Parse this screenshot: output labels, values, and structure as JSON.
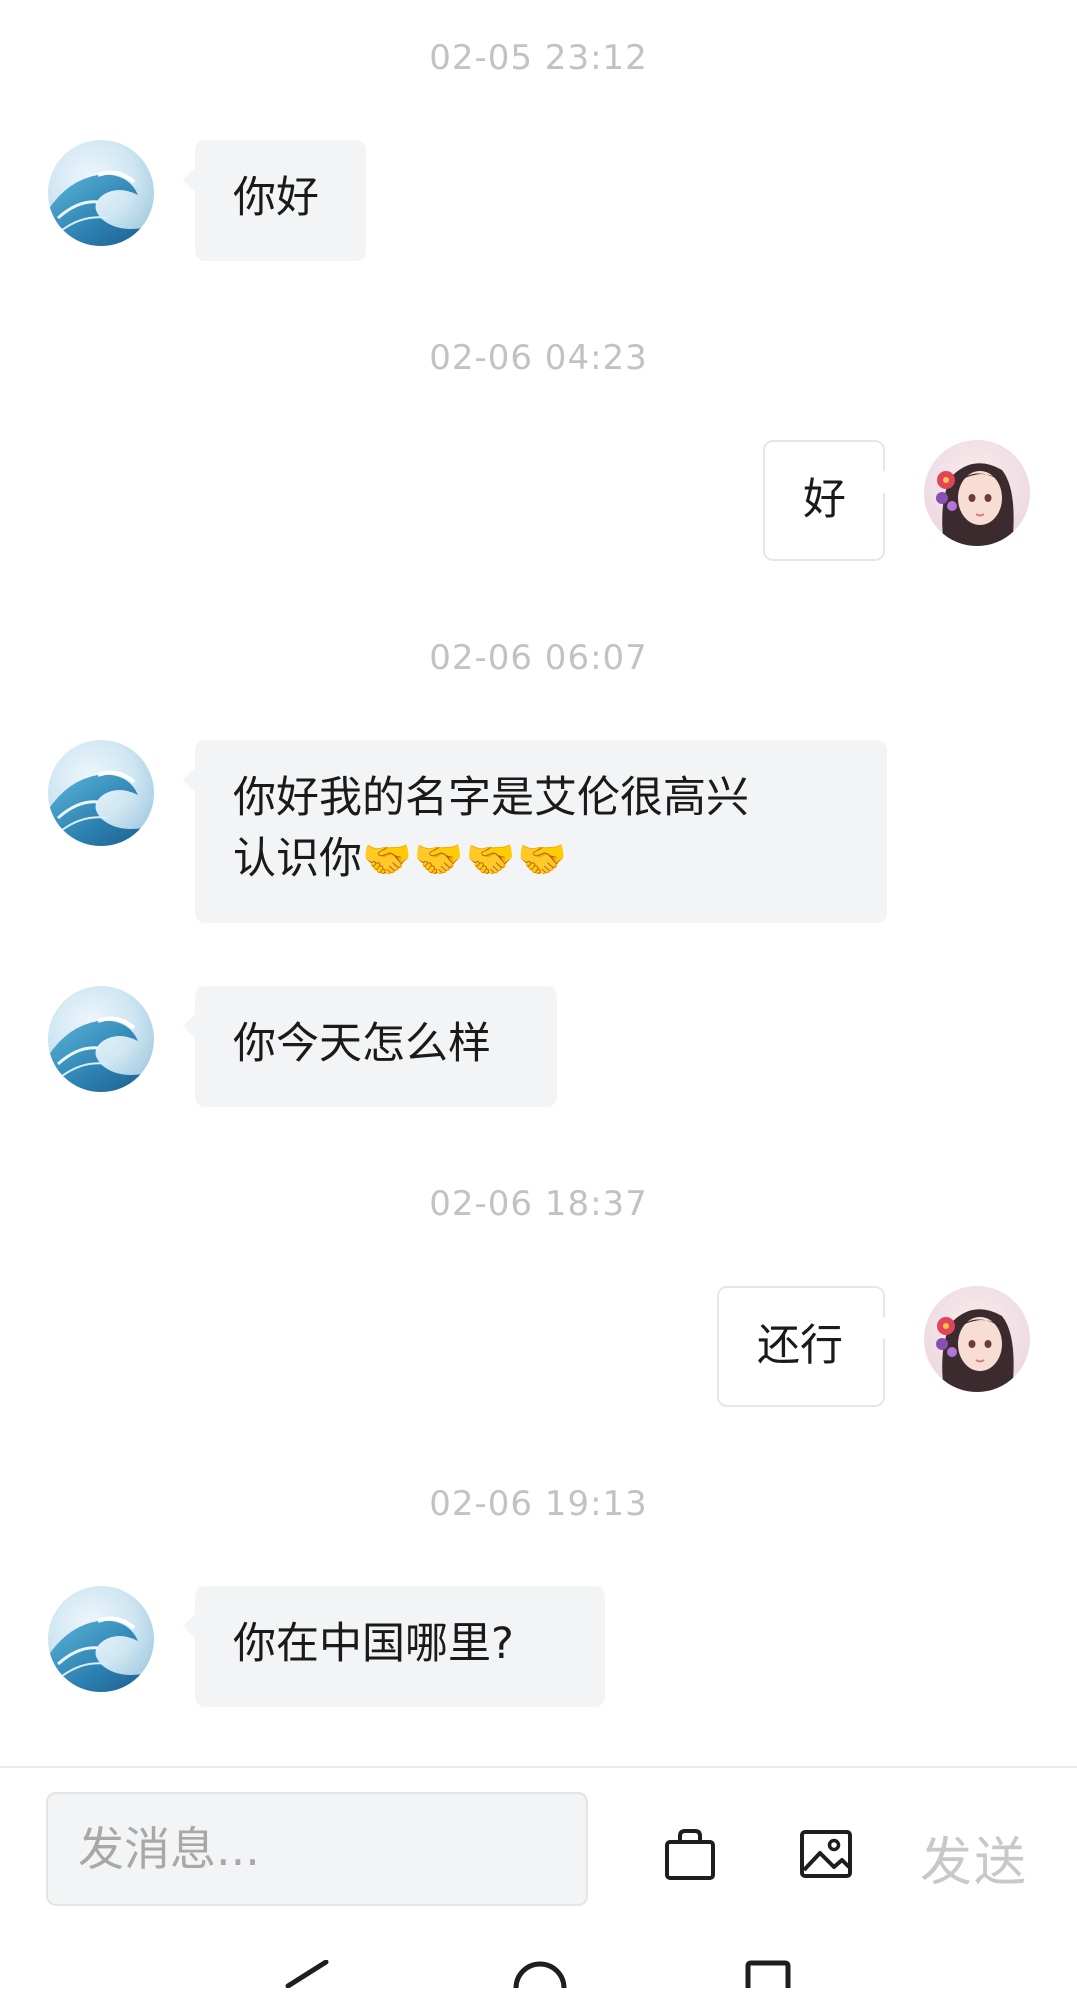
{
  "messages": [
    {
      "timestamp": "02-05 23:12",
      "side": "left",
      "text": "你好"
    },
    {
      "timestamp": "02-06 04:23",
      "side": "right",
      "text": "好"
    },
    {
      "timestamp": "02-06 06:07",
      "side": "left",
      "text": "你好我的名字是艾伦很高兴",
      "text_line2": "认识你",
      "emoji": "🤝🤝🤝🤝"
    },
    {
      "side": "left",
      "text": "你今天怎么样"
    },
    {
      "timestamp": "02-06 18:37",
      "side": "right",
      "text": "还行"
    },
    {
      "timestamp": "02-06 19:13",
      "side": "left",
      "text": "你在中国哪里?"
    }
  ],
  "composer": {
    "placeholder": "发消息...",
    "send_label": "发送",
    "icons": [
      "shopping-bag-icon",
      "image-icon"
    ]
  },
  "nav_icons": [
    "back-icon",
    "home-icon",
    "recents-icon"
  ],
  "colors": {
    "bubble_left": "#f3f4f5",
    "bubble_right": "#ffffff",
    "timestamp": "#c2c2c2",
    "send_disabled": "#c8c8c8"
  }
}
